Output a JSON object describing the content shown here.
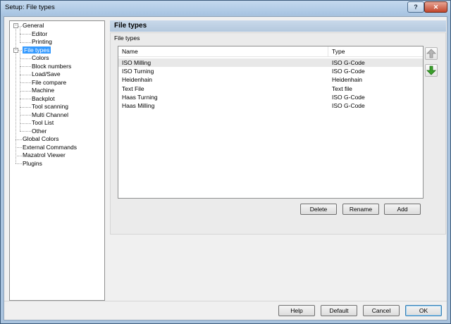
{
  "window": {
    "title": "Setup: File types",
    "help_glyph": "?",
    "close_glyph": "✕"
  },
  "tree": [
    {
      "label": "General",
      "expander": "-"
    },
    {
      "label": "Editor"
    },
    {
      "label": "Printing"
    },
    {
      "label": "File types",
      "expander": "-",
      "selected": true
    },
    {
      "label": "Colors"
    },
    {
      "label": "Block numbers"
    },
    {
      "label": "Load/Save"
    },
    {
      "label": "File compare"
    },
    {
      "label": "Machine"
    },
    {
      "label": "Backplot"
    },
    {
      "label": "Tool scanning"
    },
    {
      "label": "Multi Channel"
    },
    {
      "label": "Tool List"
    },
    {
      "label": "Other"
    },
    {
      "label": "Global Colors"
    },
    {
      "label": "External Commands"
    },
    {
      "label": "Mazatrol Viewer"
    },
    {
      "label": "Plugins"
    }
  ],
  "panel": {
    "title": "File types",
    "group_label": "File types",
    "columns": {
      "name": "Name",
      "type": "Type"
    },
    "rows": [
      {
        "name": "ISO Milling",
        "type": "ISO G-Code"
      },
      {
        "name": "ISO Turning",
        "type": "ISO G-Code"
      },
      {
        "name": "Heidenhain",
        "type": "Heidenhain"
      },
      {
        "name": "Text File",
        "type": "Text file"
      },
      {
        "name": "Haas Turning",
        "type": "ISO G-Code"
      },
      {
        "name": "Haas Milling",
        "type": "ISO G-Code"
      }
    ],
    "selected_row": 0,
    "buttons": {
      "delete": "Delete",
      "rename": "Rename",
      "add": "Add"
    },
    "move_up_icon": "arrow-up-gray",
    "move_down_icon": "arrow-down-green"
  },
  "footer": {
    "help": "Help",
    "default": "Default",
    "cancel": "Cancel",
    "ok": "OK"
  },
  "colors": {
    "selection": "#3399ff",
    "header_band": "#bfd2e6",
    "down_arrow": "#3aa02a",
    "up_arrow": "#9a9a9a"
  }
}
